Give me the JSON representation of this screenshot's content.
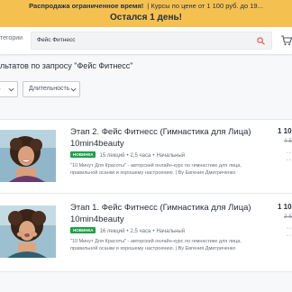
{
  "promo": {
    "lead": "Распродажа ограниченное время!",
    "offer": "| Курсы по цене от 1 100 руб. до 19...",
    "countdown": "Остался 1 день!",
    "bg_color": "#f4c150"
  },
  "header": {
    "categories_label": "тегории",
    "search": {
      "value": "Фейс Фитнесс",
      "placeholder": ""
    },
    "search_icon": "search-icon",
    "cart_icon": "cart-icon",
    "accent_color": "#ec5252"
  },
  "results": {
    "title": "льтатов по запросу \"Фейс Фитнесс\""
  },
  "filters": {
    "level_label": "нь",
    "duration_label": "Длительность"
  },
  "courses": [
    {
      "title": "Этап 2. Фейс Фитнесс (Гимнастика для Лица) 10min4beauty",
      "badge": "НОВИНКА",
      "lectures": "15 лекций",
      "duration": "2,5 часа",
      "level": "Начальный",
      "description": "\"10 Минут Для Красоты\" - авторский онлайн-курс по гимнастике для лица, правильной осанки и хорошему настроению. | By Евгения Дмитриченко",
      "price": "1 10",
      "old_price": "4 5",
      "badge_color": "#1ea14a"
    },
    {
      "title": "Этап 1. Фейс Фитнесс (Гимнастика для Лица) 10min4beauty",
      "badge": "НОВИНКА",
      "lectures": "16 лекций",
      "duration": "2,5 часа",
      "level": "Начальный",
      "description": "\"10 Минут Для Красоты\" - авторский онлайн-курс по гимнастике для лица, правильной осанки и хорошему настроению. | By Евгения Дмитриченко",
      "price": "1 10",
      "old_price": "3 5",
      "badge_color": "#1ea14a"
    }
  ]
}
